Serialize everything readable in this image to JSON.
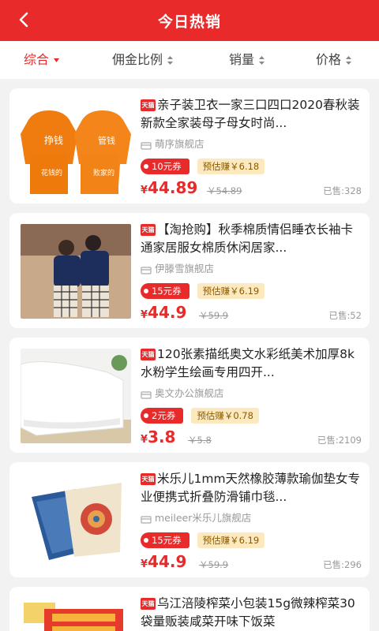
{
  "header": {
    "title": "今日热销",
    "back_icon": "back-arrow-icon",
    "color": "#e92a2a"
  },
  "tabs": [
    {
      "label": "综合",
      "active": true
    },
    {
      "label": "佣金比例",
      "active": false
    },
    {
      "label": "销量",
      "active": false
    },
    {
      "label": "价格",
      "active": false
    }
  ],
  "products": [
    {
      "badge": "天猫",
      "title": "亲子装卫衣一家三口四口2020春秋装新款全家装母子母女时尚...",
      "shop": "萌序旗舰店",
      "coupon": "10元券",
      "earn": "预估赚￥6.18",
      "currency": "¥",
      "price": "44.89",
      "original": "￥54.89",
      "sold": "已售:328"
    },
    {
      "badge": "天猫",
      "title": "【淘抢购】秋季棉质情侣睡衣长袖卡通家居服女棉质休闲居家...",
      "shop": "伊滕雪旗舰店",
      "coupon": "15元券",
      "earn": "预估赚￥6.19",
      "currency": "¥",
      "price": "44.9",
      "original": "￥59.9",
      "sold": "已售:52"
    },
    {
      "badge": "天猫",
      "title": "120张素描纸奥文水彩纸美术加厚8k水粉学生绘画专用四开...",
      "shop": "奥文办公旗舰店",
      "coupon": "2元券",
      "earn": "预估赚￥0.78",
      "currency": "¥",
      "price": "3.8",
      "original": "￥5.8",
      "sold": "已售:2109"
    },
    {
      "badge": "天猫",
      "title": "米乐儿1mm天然橡胶薄款瑜伽垫女专业便携式折叠防滑铺巾毯...",
      "shop": "meileer米乐儿旗舰店",
      "coupon": "15元券",
      "earn": "预估赚￥6.19",
      "currency": "¥",
      "price": "44.9",
      "original": "￥59.9",
      "sold": "已售:296"
    },
    {
      "badge": "天猫",
      "title": "乌江涪陵榨菜小包装15g微辣榨菜30袋量贩装咸菜开味下饭菜",
      "shop": "",
      "coupon": "",
      "earn": "",
      "currency": "",
      "price": "",
      "original": "",
      "sold": ""
    }
  ]
}
